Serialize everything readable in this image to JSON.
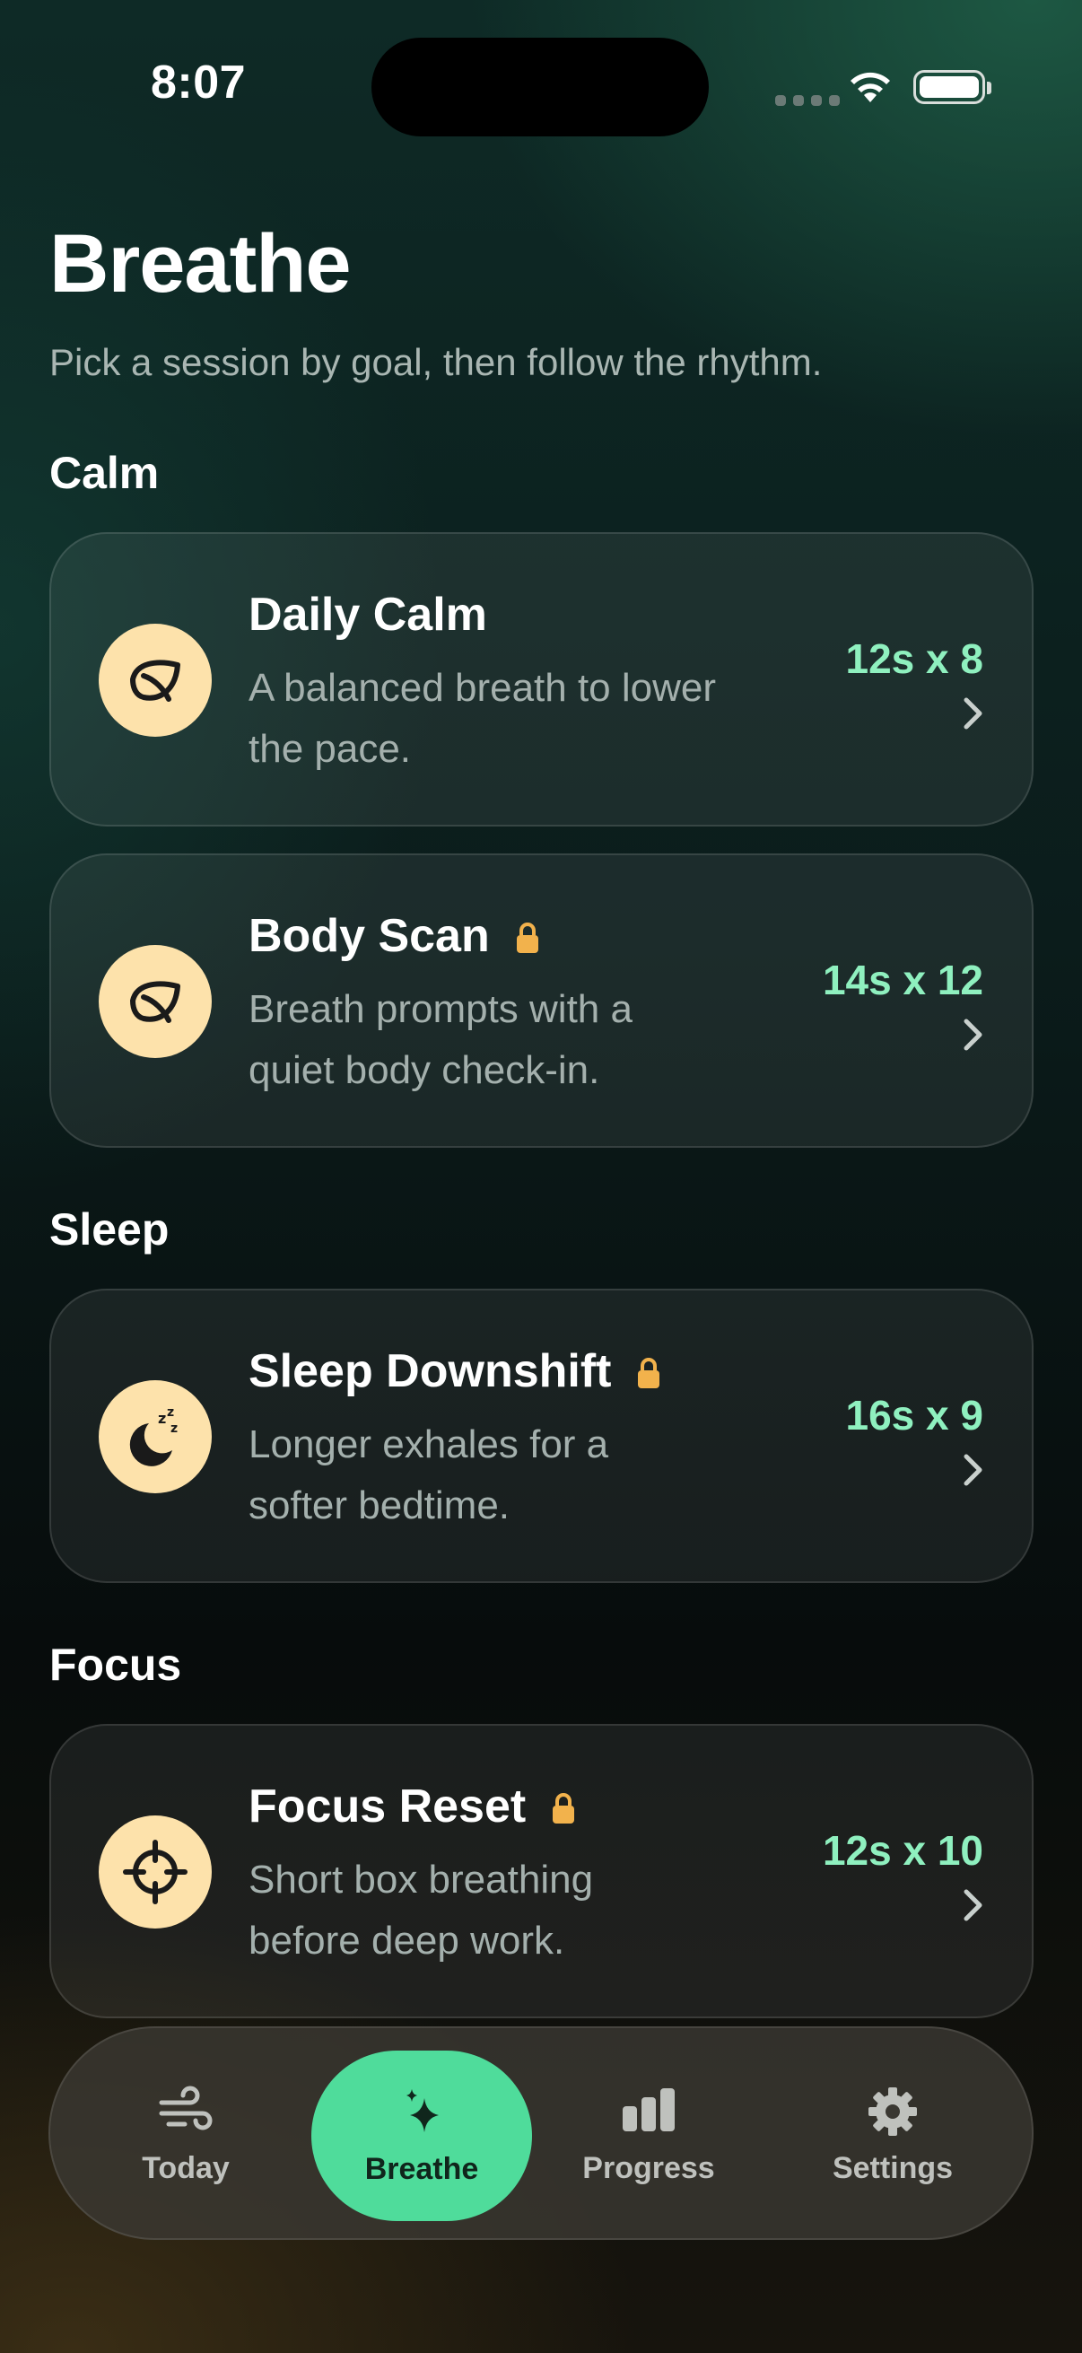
{
  "status_bar": {
    "time": "8:07"
  },
  "header": {
    "title": "Breathe",
    "subtitle": "Pick a session by goal, then follow the rhythm."
  },
  "sections": {
    "calm": "Calm",
    "sleep": "Sleep",
    "focus": "Focus"
  },
  "sessions": [
    {
      "title": "Daily Calm",
      "locked": false,
      "desc_line1": "A balanced breath to lower",
      "desc_line2": "the pace.",
      "meta": "12s x 8",
      "icon": "leaf-icon"
    },
    {
      "title": "Body Scan",
      "locked": true,
      "desc_line1": "Breath prompts with a",
      "desc_line2": "quiet body check-in.",
      "meta": "14s x 12",
      "icon": "leaf-icon"
    },
    {
      "title": "Sleep Downshift",
      "locked": true,
      "desc_line1": "Longer exhales for a",
      "desc_line2": "softer bedtime.",
      "meta": "16s x 9",
      "icon": "moon-sleep-icon"
    },
    {
      "title": "Focus Reset",
      "locked": true,
      "desc_line1": "Short box breathing",
      "desc_line2": "before deep work.",
      "meta": "12s x 10",
      "icon": "crosshair-icon"
    }
  ],
  "tab_bar": {
    "items": [
      {
        "label": "Today",
        "icon": "wind-icon",
        "active": false
      },
      {
        "label": "Breathe",
        "icon": "sparkle-icon",
        "active": true
      },
      {
        "label": "Progress",
        "icon": "bar-chart-icon",
        "active": false
      },
      {
        "label": "Settings",
        "icon": "gear-icon",
        "active": false
      }
    ]
  },
  "colors": {
    "accent": "#4fdc9b",
    "meta_text": "#8ff0bf",
    "icon_bg": "#fde2ab",
    "lock": "#f2b24c"
  }
}
